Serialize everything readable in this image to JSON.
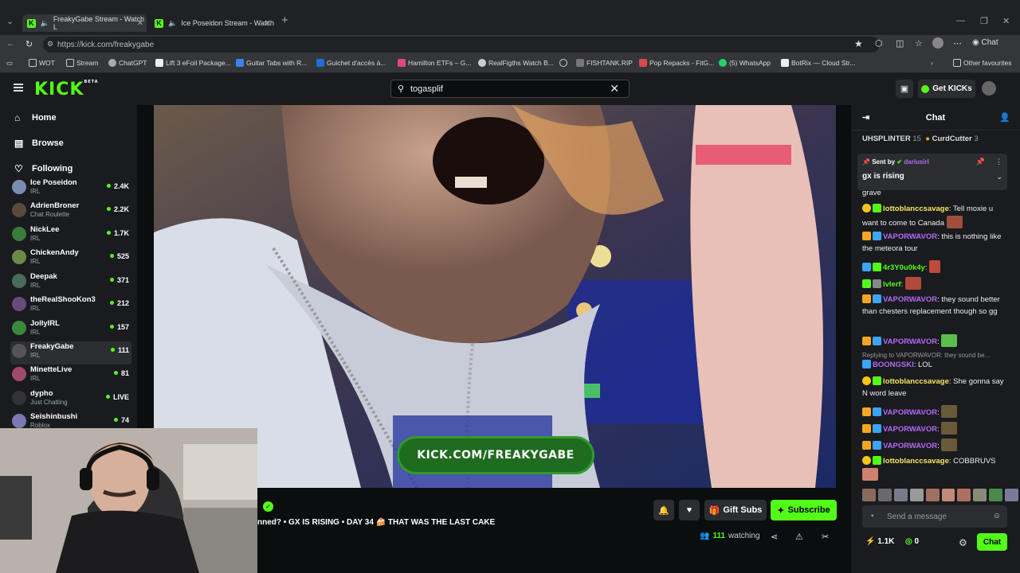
{
  "browser": {
    "tabs": [
      {
        "label": "FreakyGabe Stream - Watch L"
      },
      {
        "label": "Ice Poseidon Stream - Watch"
      }
    ],
    "url": "https://kick.com/freakygabe",
    "bookmarks": [
      "WOT",
      "Stream",
      "ChatGPT",
      "Lift 3 eFoil Package...",
      "Guitar Tabs with R...",
      "Guichet d'accès à...",
      "Hamilton ETFs – G...",
      "RealFigths Watch B...",
      "FISHTANK.RIP",
      "Pop Repacks - FitG...",
      "(5) WhatsApp",
      "BotRix — Cloud Str...",
      "Other favourites"
    ]
  },
  "header": {
    "logo": "KICK",
    "logo_badge": "BETA",
    "search_value": "togasplif",
    "get_kicks": "Get KICKs"
  },
  "sidebar": {
    "nav": [
      {
        "label": "Home"
      },
      {
        "label": "Browse"
      },
      {
        "label": "Following"
      }
    ],
    "channels": [
      {
        "name": "Ice Poseidon",
        "category": "IRL",
        "viewers": "2.4K",
        "color": "#7a8db0"
      },
      {
        "name": "AdrienBroner",
        "category": "Chat Roulette",
        "viewers": "2.2K",
        "color": "#5a4a3e"
      },
      {
        "name": "NickLee",
        "category": "IRL",
        "viewers": "1.7K",
        "color": "#3a7a3a"
      },
      {
        "name": "ChickenAndy",
        "category": "IRL",
        "viewers": "525",
        "color": "#6a8a4a"
      },
      {
        "name": "Deepak",
        "category": "IRL",
        "viewers": "371",
        "color": "#4a6a5a"
      },
      {
        "name": "theRealShooKon3",
        "category": "IRL",
        "viewers": "212",
        "color": "#6a4a7a"
      },
      {
        "name": "JollyIRL",
        "category": "IRL",
        "viewers": "157",
        "color": "#3a8a3a"
      },
      {
        "name": "FreakyGabe",
        "category": "IRL",
        "viewers": "111",
        "color": "#555555"
      },
      {
        "name": "MinetteLive",
        "category": "IRL",
        "viewers": "81",
        "color": "#a04a6a"
      },
      {
        "name": "dypho",
        "category": "Just Chatting",
        "viewers": "LIVE",
        "color": "#333333"
      },
      {
        "name": "Seishinbushi",
        "category": "Roblox",
        "viewers": "74",
        "color": "#7a7ab0"
      }
    ]
  },
  "stream": {
    "overlay_text": "KICK.COM/FREAKYGABE",
    "title": "nned? • GX IS RISING • DAY 34 🍰 THAT WAS THE LAST CAKE",
    "gift_subs": "Gift Subs",
    "subscribe": "Subscribe",
    "watching_count": "111",
    "watching_label": "watching"
  },
  "chat": {
    "title": "Chat",
    "leaderboard": [
      {
        "name": "UHSPLINTER",
        "count": "15"
      },
      {
        "name": "CurdCutter",
        "count": "3"
      }
    ],
    "pinned": {
      "sent_by_label": "Sent by",
      "user": "dariusirl",
      "message": "gx is rising"
    },
    "messages": [
      {
        "user": "",
        "text": "grave",
        "color": "#eeeeee"
      },
      {
        "user": "lottoblanccsavage",
        "text": "Tell moxie u want to come to Canada",
        "color": "#f5e663"
      },
      {
        "user": "VAPORWAVOR",
        "text": "this is nothing like the meteora tour",
        "color": "#b36bf5"
      },
      {
        "user": "4r3Y0u0k4y",
        "text": "",
        "color": "#53fc18"
      },
      {
        "user": "lvlerf",
        "text": "",
        "color": "#53fc18"
      },
      {
        "user": "VAPORWAVOR",
        "text": "they sound better than chesters replacement though so gg",
        "color": "#b36bf5"
      },
      {
        "user": "VAPORWAVOR",
        "text": "",
        "color": "#b36bf5"
      },
      {
        "user": "BOONGSKI",
        "text": "LOL",
        "color": "#b36bf5"
      },
      {
        "user": "lottoblanccsavage",
        "text": "She gonna say N word leave",
        "color": "#f5e663"
      },
      {
        "user": "VAPORWAVOR",
        "text": "",
        "color": "#b36bf5"
      },
      {
        "user": "VAPORWAVOR",
        "text": "",
        "color": "#b36bf5"
      },
      {
        "user": "VAPORWAVOR",
        "text": "",
        "color": "#b36bf5"
      },
      {
        "user": "lottoblanccsavage",
        "text": "COBBRUVS",
        "color": "#f5e663"
      }
    ],
    "reply_context": "Replying to VAPORWAVOR: they sound be...",
    "input_placeholder": "Send a message",
    "kicks": "1.1K",
    "points": "0",
    "chat_button": "Chat"
  }
}
